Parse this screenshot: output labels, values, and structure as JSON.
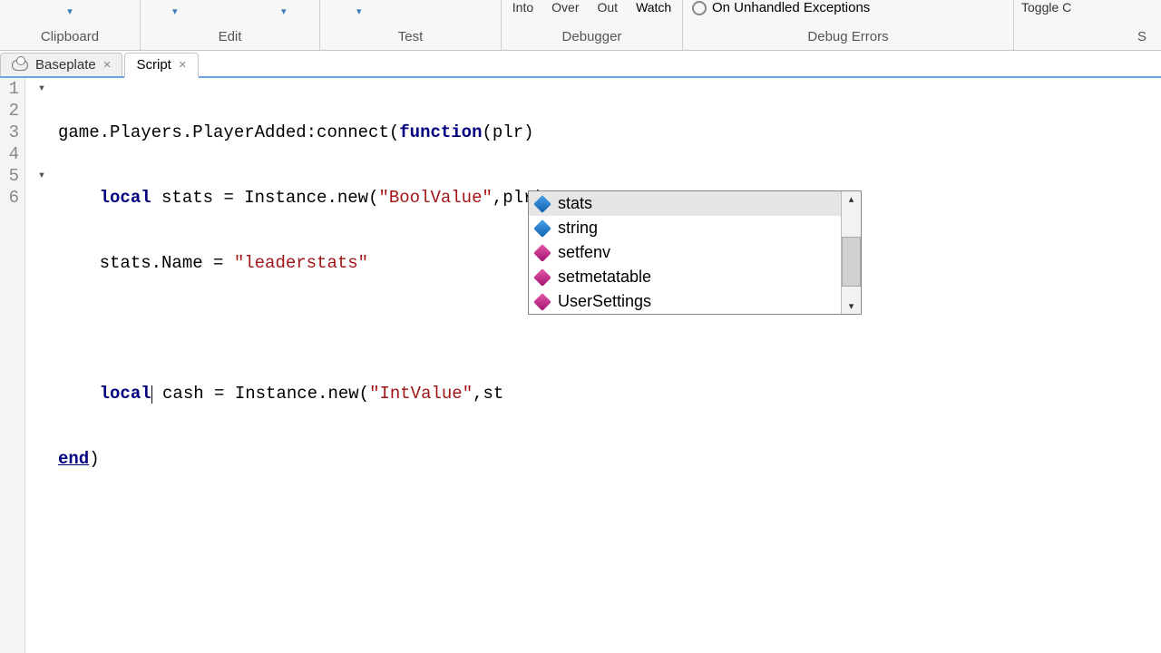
{
  "ribbon": {
    "clipboard": {
      "label": "Clipboard"
    },
    "edit": {
      "label": "Edit"
    },
    "test": {
      "label": "Test"
    },
    "debugger": {
      "label": "Debugger",
      "into": "Into",
      "over": "Over",
      "out": "Out",
      "watch": "Watch"
    },
    "debugerrors": {
      "label": "Debug Errors",
      "option": "On Unhandled Exceptions"
    },
    "settings": {
      "toggle": "Toggle C",
      "label2": "S"
    }
  },
  "tabs": {
    "items": [
      {
        "label": "Baseplate"
      },
      {
        "label": "Script"
      }
    ]
  },
  "code": {
    "lines": [
      "1",
      "2",
      "3",
      "4",
      "5",
      "6"
    ],
    "l1_a": "game.Players.PlayerAdded:connect(",
    "l1_b": "function",
    "l1_c": "(plr)",
    "l2_a": "    ",
    "l2_b": "local",
    "l2_c": " stats = Instance.new(",
    "l2_d": "\"BoolValue\"",
    "l2_e": ",plr)",
    "l3_a": "    stats.Name = ",
    "l3_b": "\"leaderstats\"",
    "l5_a": "    ",
    "l5_b": "local",
    "l5_c": " cash = Instance.new(",
    "l5_d": "\"IntValue\"",
    "l5_e": ",st",
    "l6_a": "end",
    "l6_b": ")"
  },
  "autocomplete": {
    "items": [
      {
        "label": "stats",
        "kind": "blue"
      },
      {
        "label": "string",
        "kind": "blue"
      },
      {
        "label": "setfenv",
        "kind": "pink"
      },
      {
        "label": "setmetatable",
        "kind": "pink"
      },
      {
        "label": "UserSettings",
        "kind": "pink"
      }
    ]
  }
}
